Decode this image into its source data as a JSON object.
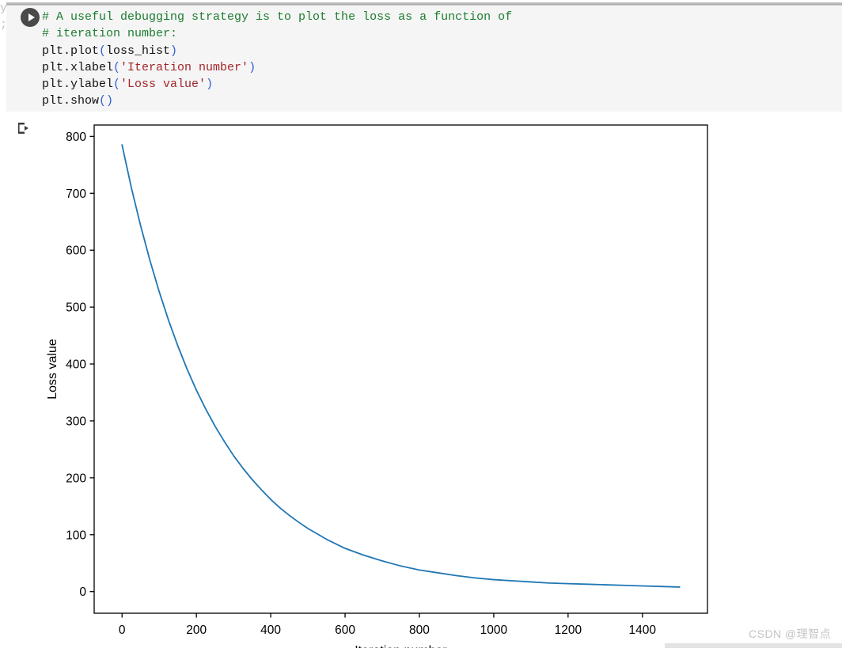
{
  "notebook": {
    "gutter_ghost_text": "y\n;\n\n\n\n\n",
    "run_button_label": "run-cell",
    "output_icon_label": "output-arrow",
    "code_lines": [
      [
        {
          "t": "comment",
          "s": "# A useful debugging strategy is to plot the loss as a function of"
        }
      ],
      [
        {
          "t": "comment",
          "s": "# iteration number:"
        }
      ],
      [
        {
          "t": "plain",
          "s": "plt.plot"
        },
        {
          "t": "paren",
          "s": "("
        },
        {
          "t": "plain",
          "s": "loss_hist"
        },
        {
          "t": "paren",
          "s": ")"
        }
      ],
      [
        {
          "t": "plain",
          "s": "plt.xlabel"
        },
        {
          "t": "paren",
          "s": "("
        },
        {
          "t": "str",
          "s": "'Iteration number'"
        },
        {
          "t": "paren",
          "s": ")"
        }
      ],
      [
        {
          "t": "plain",
          "s": "plt.ylabel"
        },
        {
          "t": "paren",
          "s": "("
        },
        {
          "t": "str",
          "s": "'Loss value'"
        },
        {
          "t": "paren",
          "s": ")"
        }
      ],
      [
        {
          "t": "plain",
          "s": "plt.show"
        },
        {
          "t": "paren",
          "s": "("
        },
        {
          "t": "paren",
          "s": ")"
        }
      ]
    ]
  },
  "watermark": {
    "text": "CSDN @理智点"
  },
  "colors": {
    "line": "#1f77b4",
    "axis": "#000000",
    "cell_background": "#f5f5f5",
    "comment": "#1d7d30",
    "string": "#a3252b",
    "paren": "#2f5fd0"
  },
  "chart_data": {
    "type": "line",
    "title": "",
    "xlabel": "Iteration number",
    "ylabel": "Loss value",
    "xlim": [
      -75,
      1575
    ],
    "ylim": [
      -38,
      820
    ],
    "xticks": [
      0,
      200,
      400,
      600,
      800,
      1000,
      1200,
      1400
    ],
    "xtick_labels": [
      "0",
      "200",
      "400",
      "600",
      "800",
      "1000",
      "1200",
      "1400"
    ],
    "yticks": [
      0,
      100,
      200,
      300,
      400,
      500,
      600,
      700,
      800
    ],
    "ytick_labels": [
      "0",
      "100",
      "200",
      "300",
      "400",
      "500",
      "600",
      "700",
      "800"
    ],
    "grid": false,
    "legend": null,
    "series": [
      {
        "name": "loss_hist",
        "color": "#1f77b4",
        "linewidth": 1.8,
        "x": [
          0,
          25,
          50,
          75,
          100,
          125,
          150,
          175,
          200,
          225,
          250,
          275,
          300,
          325,
          350,
          375,
          400,
          425,
          450,
          475,
          500,
          550,
          600,
          650,
          700,
          750,
          800,
          850,
          900,
          950,
          1000,
          1050,
          1100,
          1150,
          1200,
          1250,
          1300,
          1350,
          1400,
          1450,
          1500
        ],
        "y": [
          785,
          710,
          643,
          582,
          527,
          477,
          432,
          391,
          354,
          321,
          291,
          264,
          239,
          217,
          197,
          179,
          162,
          147,
          134,
          122,
          111,
          92,
          76,
          64,
          54,
          45,
          38,
          33,
          28,
          24,
          21,
          19,
          17,
          15,
          14,
          13,
          12,
          11,
          10,
          9,
          8
        ]
      }
    ]
  }
}
